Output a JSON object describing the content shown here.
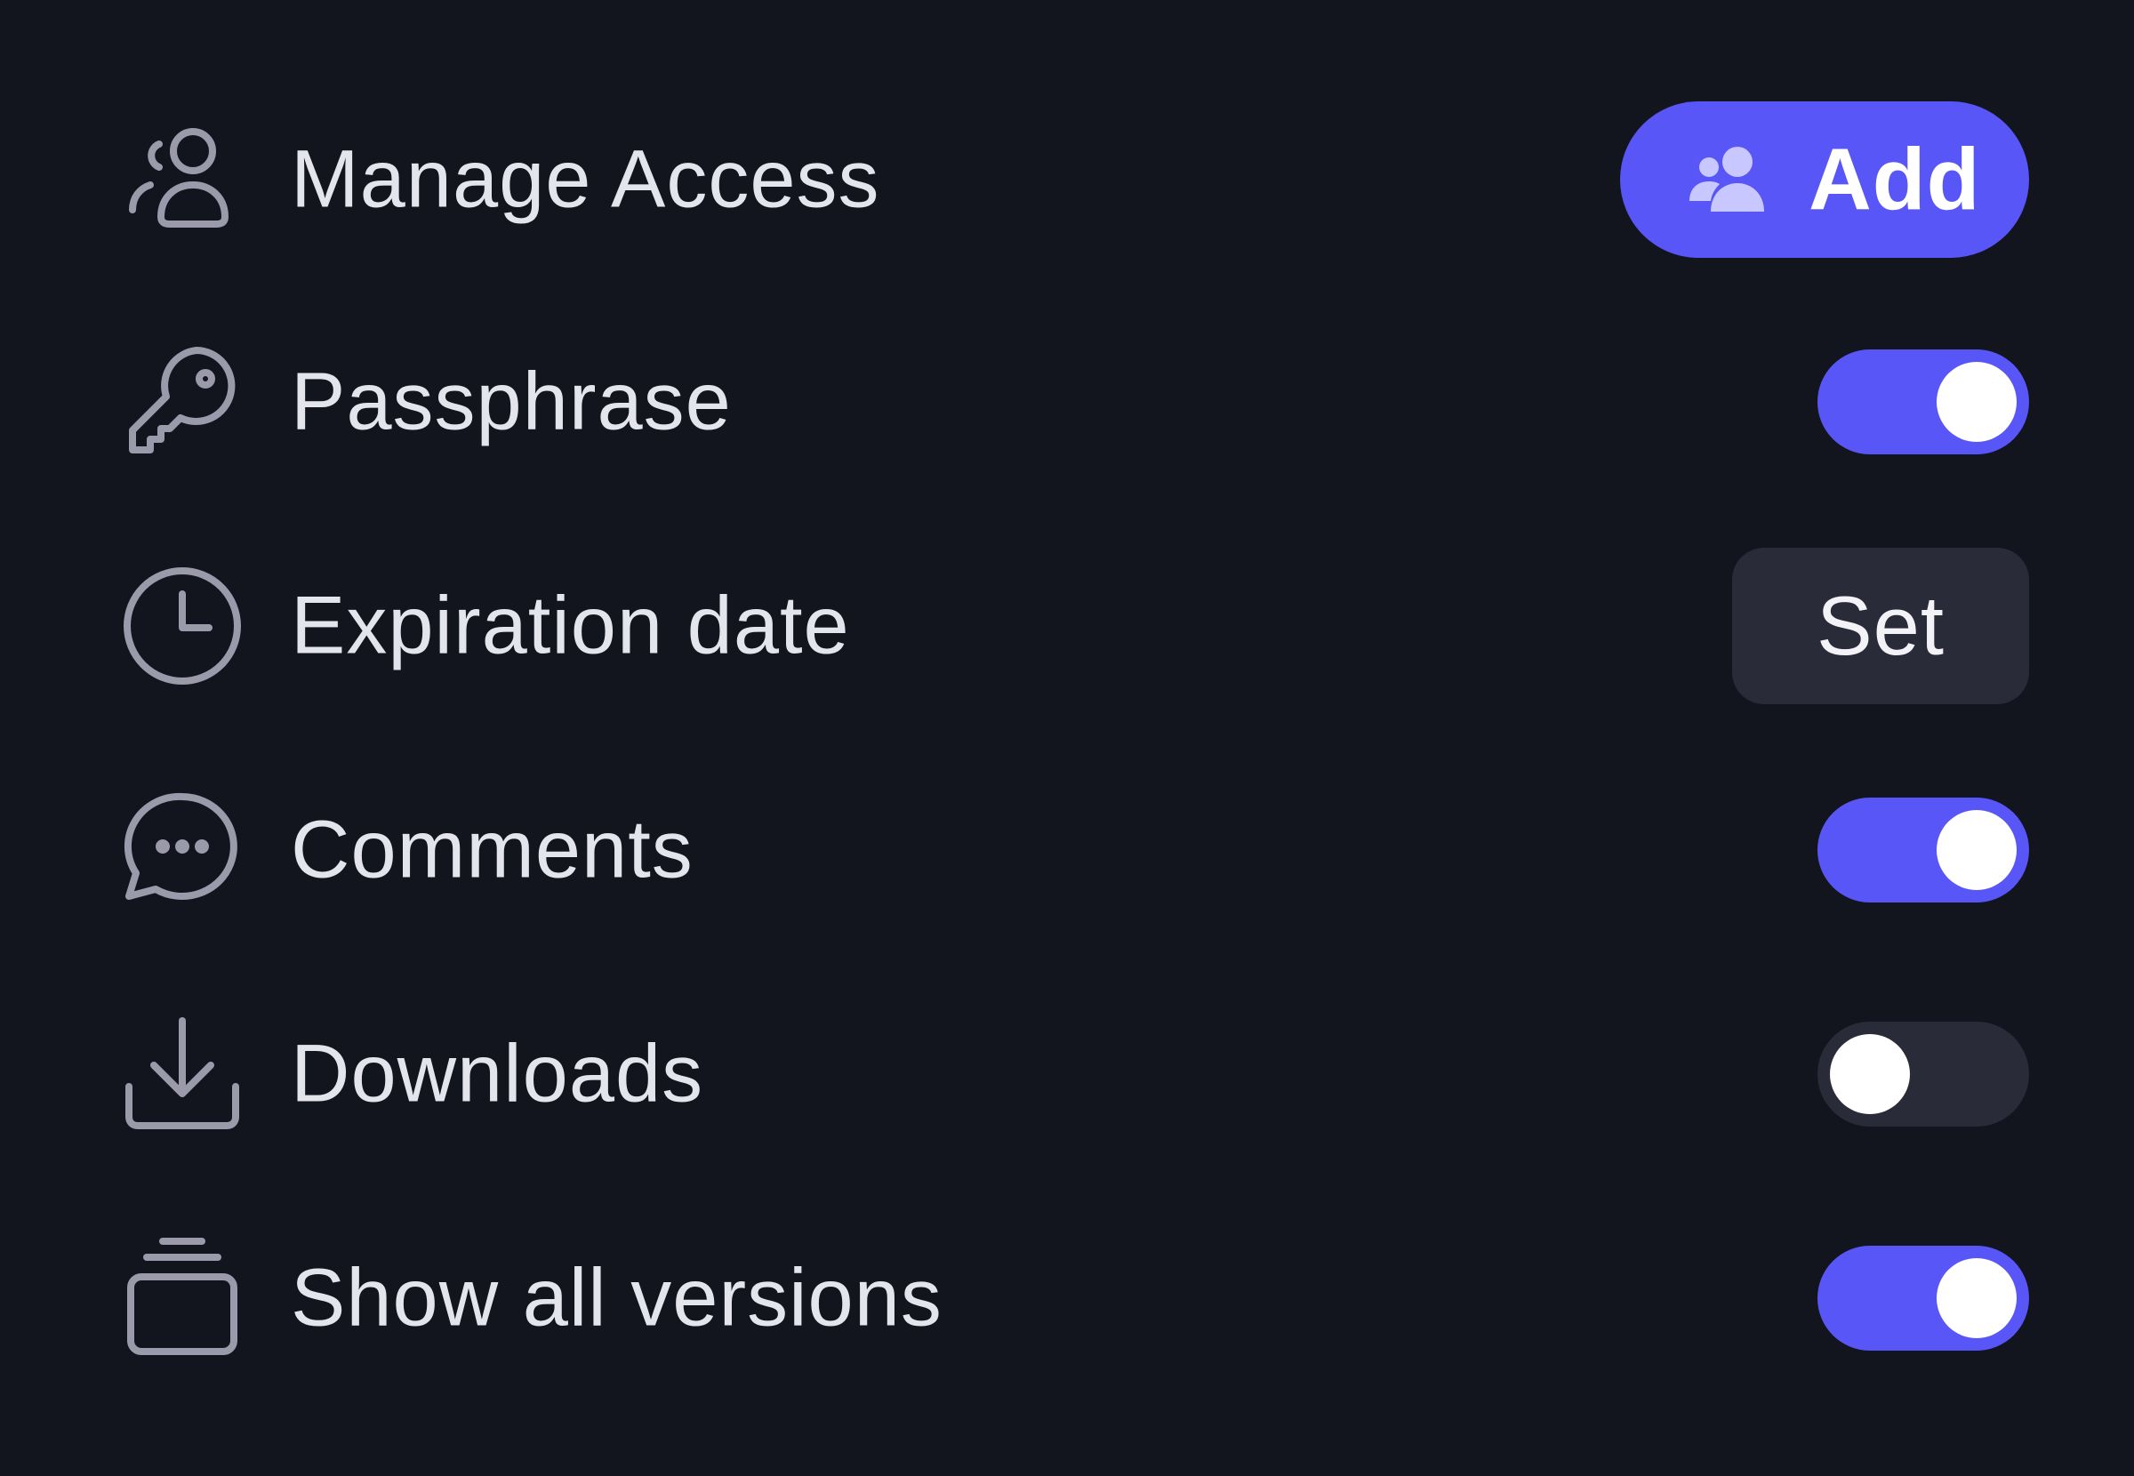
{
  "settings": {
    "manage_access": {
      "label": "Manage Access",
      "icon": "users-icon",
      "button_label": "Add",
      "button_icon": "users-add-icon"
    },
    "passphrase": {
      "label": "Passphrase",
      "icon": "key-icon",
      "enabled": true
    },
    "expiration": {
      "label": "Expiration date",
      "icon": "clock-icon",
      "button_label": "Set"
    },
    "comments": {
      "label": "Comments",
      "icon": "comment-icon",
      "enabled": true
    },
    "downloads": {
      "label": "Downloads",
      "icon": "download-icon",
      "enabled": false
    },
    "versions": {
      "label": "Show all versions",
      "icon": "stack-icon",
      "enabled": true
    }
  },
  "colors": {
    "background": "#13151e",
    "accent": "#5956f8",
    "secondary_button": "#2a2b39",
    "label_text": "#e4e4ec",
    "icon": "#9a9aab"
  }
}
